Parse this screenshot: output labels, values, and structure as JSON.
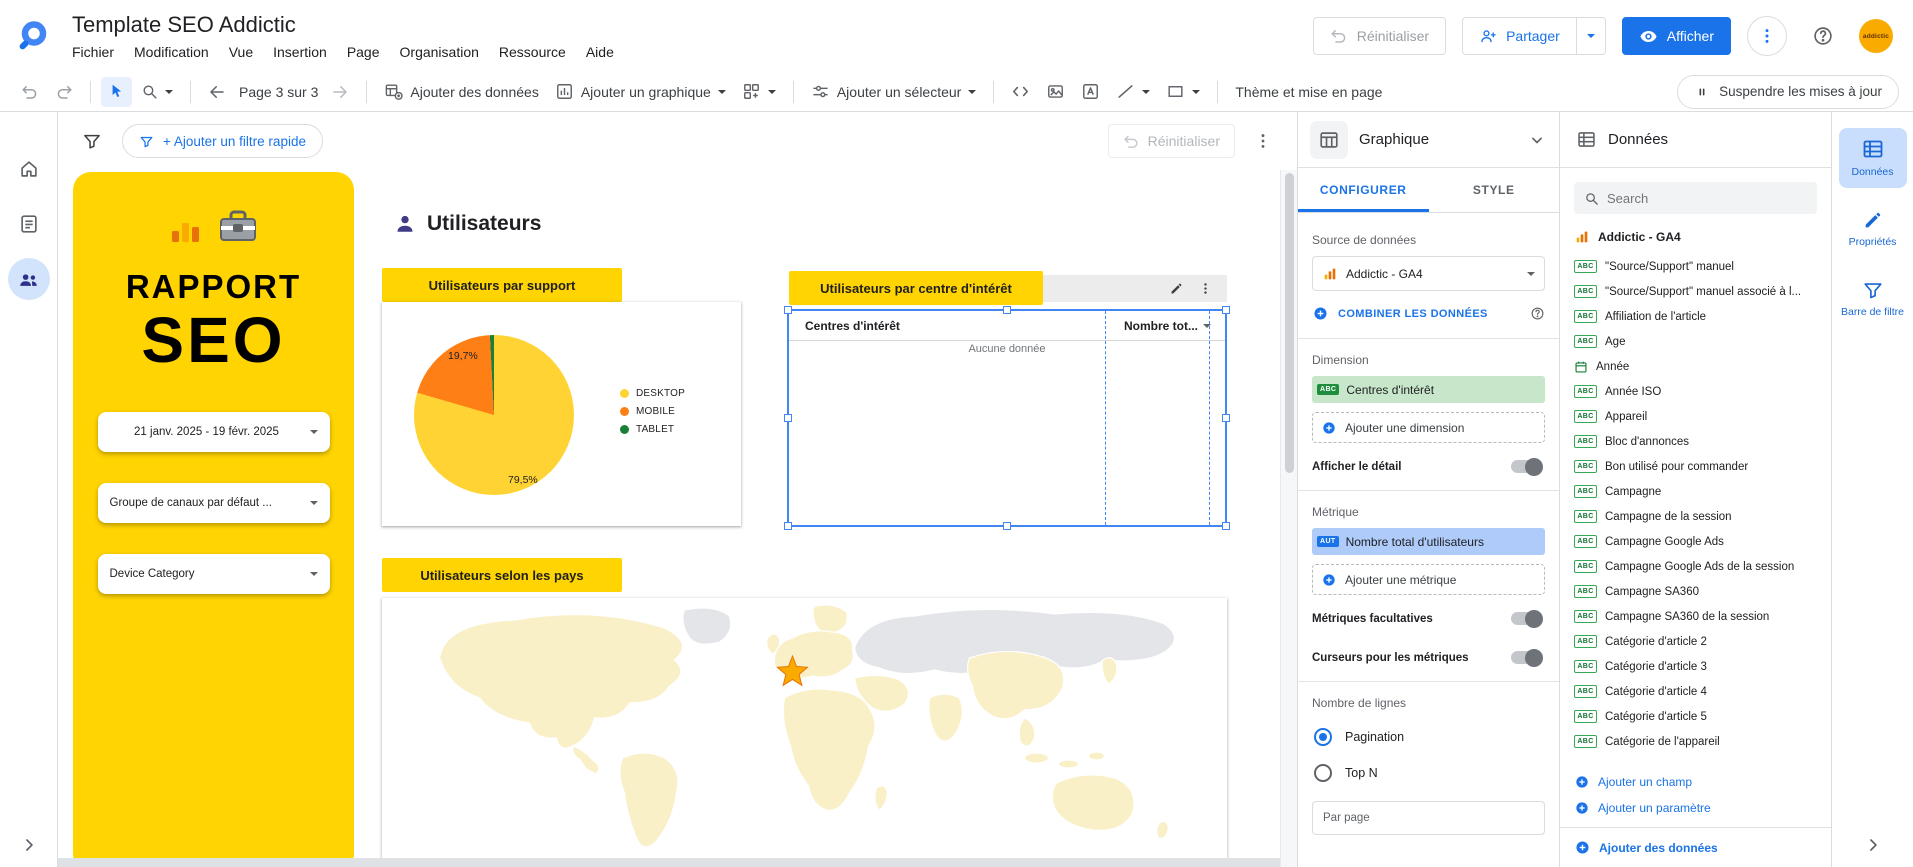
{
  "header": {
    "title": "Template SEO Addictic",
    "menus": [
      "Fichier",
      "Modification",
      "Vue",
      "Insertion",
      "Page",
      "Organisation",
      "Ressource",
      "Aide"
    ],
    "reset_label": "Réinitialiser",
    "share_label": "Partager",
    "view_label": "Afficher",
    "avatar_label": "addictic"
  },
  "toolbar": {
    "page_indicator": "Page 3 sur 3",
    "add_data_label": "Ajouter des données",
    "add_chart_label": "Ajouter un graphique",
    "add_selector_label": "Ajouter un sélecteur",
    "theme_label": "Thème et mise en page",
    "pause_label": "Suspendre les mises à jour"
  },
  "filter_bar": {
    "quick_filter_label": "+ Ajouter un filtre rapide",
    "reset_label": "Réinitialiser"
  },
  "canvas": {
    "report_card": {
      "title_line1": "RAPPORT",
      "title_line2": "SEO",
      "date_range": "21 janv. 2025 - 19 févr. 2025",
      "channel_dropdown": "Groupe de canaux par défaut ...",
      "device_dropdown": "Device Category"
    },
    "section_title": "Utilisateurs"
  },
  "chart_data": [
    {
      "type": "pie",
      "title": "Utilisateurs par support",
      "labels": [
        "DESKTOP",
        "MOBILE",
        "TABLET"
      ],
      "values": [
        79.5,
        19.7,
        0.8
      ],
      "value_labels": [
        "79,5%",
        "19,7%"
      ],
      "colors": [
        "#FFD333",
        "#FF7F17",
        "#188038"
      ],
      "legend_position": "right"
    },
    {
      "type": "table",
      "title": "Utilisateurs par centre d'intérêt",
      "columns": [
        "Centres d'intérêt",
        "Nombre tot..."
      ],
      "rows": [],
      "empty_message": "Aucune donnée"
    },
    {
      "type": "geo",
      "title": "Utilisateurs selon les pays",
      "highlight": "France"
    }
  ],
  "config_panel": {
    "title": "Graphique",
    "tab_configure": "CONFIGURER",
    "tab_style": "STYLE",
    "source_label": "Source de données",
    "source_name": "Addictic  - GA4",
    "blend_label": "COMBINER LES DONNÉES",
    "dimension_label": "Dimension",
    "dimension_badge": "ABC",
    "dimension_value": "Centres d'intérêt",
    "add_dimension_label": "Ajouter une dimension",
    "drill_label": "Afficher le détail",
    "metric_label": "Métrique",
    "metric_badge": "AUT",
    "metric_value": "Nombre total d'utilisateurs",
    "add_metric_label": "Ajouter une métrique",
    "optional_metrics_label": "Métriques facultatives",
    "sliders_label": "Curseurs pour les métriques",
    "rows_label": "Nombre de lignes",
    "pagination_label": "Pagination",
    "topn_label": "Top N",
    "per_page_label": "Par page"
  },
  "data_panel": {
    "title": "Données",
    "search_placeholder": "Search",
    "source_name": "Addictic  - GA4",
    "field_badge": "ABC",
    "fields": [
      {
        "name": "\"Source/Support\" manuel",
        "type": "text"
      },
      {
        "name": "\"Source/Support\" manuel associé à l...",
        "type": "text"
      },
      {
        "name": "Affiliation de l'article",
        "type": "text"
      },
      {
        "name": "Âge",
        "type": "text"
      },
      {
        "name": "Année",
        "type": "date"
      },
      {
        "name": "Année ISO",
        "type": "text"
      },
      {
        "name": "Appareil",
        "type": "text"
      },
      {
        "name": "Bloc d'annonces",
        "type": "text"
      },
      {
        "name": "Bon utilisé pour commander",
        "type": "text"
      },
      {
        "name": "Campagne",
        "type": "text"
      },
      {
        "name": "Campagne de la session",
        "type": "text"
      },
      {
        "name": "Campagne Google Ads",
        "type": "text"
      },
      {
        "name": "Campagne Google Ads de la session",
        "type": "text"
      },
      {
        "name": "Campagne SA360",
        "type": "text"
      },
      {
        "name": "Campagne SA360 de la session",
        "type": "text"
      },
      {
        "name": "Catégorie d'article 2",
        "type": "text"
      },
      {
        "name": "Catégorie d'article 3",
        "type": "text"
      },
      {
        "name": "Catégorie d'article 4",
        "type": "text"
      },
      {
        "name": "Catégorie d'article 5",
        "type": "text"
      },
      {
        "name": "Catégorie de l'appareil",
        "type": "text"
      }
    ],
    "add_field_label": "Ajouter un champ",
    "add_parameter_label": "Ajouter un paramètre",
    "add_data_label": "Ajouter des données"
  },
  "right_rail": {
    "data_label": "Données",
    "properties_label": "Propriétés",
    "filter_label": "Barre de filtre"
  },
  "colors": {
    "accent_blue": "#1a73e8",
    "brand_yellow": "#FFD400",
    "selection_blue": "#4285f4"
  }
}
